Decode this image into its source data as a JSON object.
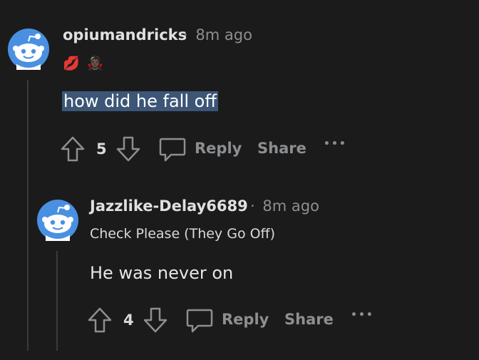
{
  "comments": [
    {
      "username": "opiumandricks",
      "separator": "·",
      "time": "8m ago",
      "flair": [
        "💋",
        "🧛🏿‍♀️"
      ],
      "text": "how did he fall off",
      "votes": "5",
      "reply_label": "Reply",
      "share_label": "Share",
      "more_label": "•••"
    },
    {
      "username": "Jazzlike-Delay6689",
      "separator": "·",
      "time": "8m ago",
      "user_flair_text": "Check Please (They Go Off)",
      "text": "He was never on",
      "votes": "4",
      "reply_label": "Reply",
      "share_label": "Share",
      "more_label": "•••"
    }
  ],
  "icons": {
    "avatar": "reddit-snoo-avatar-icon",
    "upvote": "arrow-up-icon",
    "downvote": "arrow-down-icon",
    "reply": "speech-bubble-icon"
  },
  "colors": {
    "background": "#1b1b1b",
    "avatar_bg": "#4a90e2",
    "highlight": "#3d5677",
    "muted": "#8c8f92"
  }
}
